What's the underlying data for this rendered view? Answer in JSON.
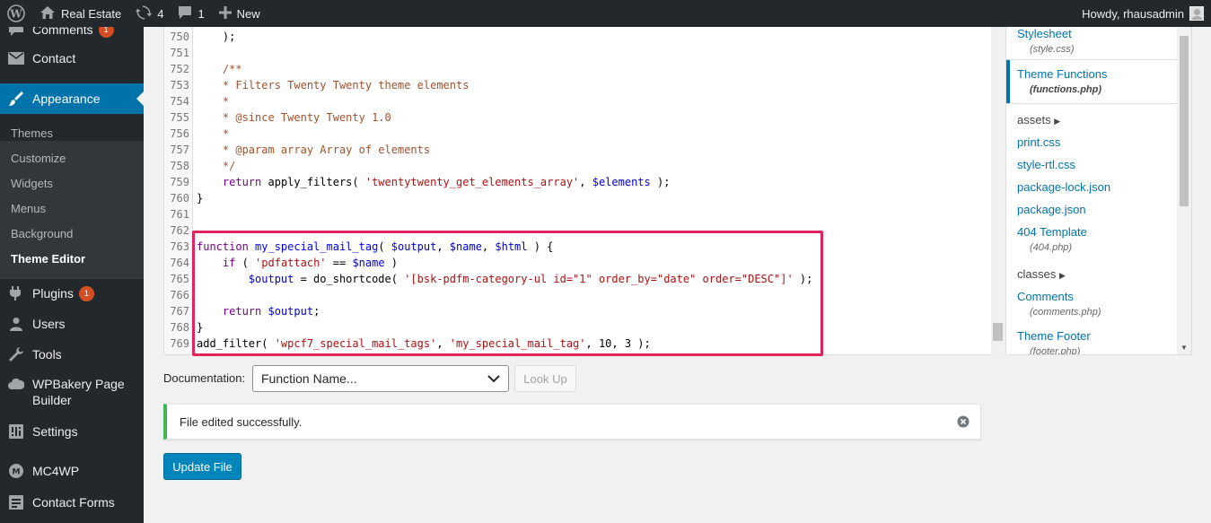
{
  "adminbar": {
    "site_name": "Real Estate",
    "updates_count": "4",
    "comments_count": "1",
    "new_label": "New",
    "howdy": "Howdy, rhausadmin"
  },
  "sidebar": {
    "comments": "Comments",
    "comments_badge": "1",
    "contact": "Contact",
    "appearance": "Appearance",
    "submenu": [
      "Themes",
      "Customize",
      "Widgets",
      "Menus",
      "Background",
      "Theme Editor"
    ],
    "plugins": "Plugins",
    "plugins_badge": "1",
    "users": "Users",
    "tools": "Tools",
    "wpbakery_line1": "WPBakery Page",
    "wpbakery_line2": "Builder",
    "settings": "Settings",
    "mc4wp": "MC4WP",
    "contact_forms": "Contact Forms"
  },
  "editor": {
    "line_numbers": [
      "750",
      "751",
      "752",
      "753",
      "754",
      "755",
      "756",
      "757",
      "758",
      "759",
      "760",
      "761",
      "762",
      "763",
      "764",
      "765",
      "766",
      "767",
      "768",
      "769"
    ]
  },
  "files": {
    "stylesheet": "Stylesheet",
    "stylesheet_file": "(style.css)",
    "theme_functions": "Theme Functions",
    "theme_functions_file": "(functions.php)",
    "assets": "assets",
    "print_css": "print.css",
    "style_rtl": "style-rtl.css",
    "package_lock": "package-lock.json",
    "package_json": "package.json",
    "template_404": "404 Template",
    "template_404_file": "(404.php)",
    "classes": "classes",
    "comments": "Comments",
    "comments_file": "(comments.php)",
    "theme_footer": "Theme Footer",
    "theme_footer_file": "(footer.php)"
  },
  "documentation": {
    "label": "Documentation:",
    "selected": "Function Name...",
    "lookup_button": "Look Up"
  },
  "notice": {
    "message": "File edited successfully."
  },
  "update_button": "Update File",
  "colors": {
    "accent": "#0073aa",
    "highlight_border": "#e1245b",
    "success": "#46b450"
  }
}
